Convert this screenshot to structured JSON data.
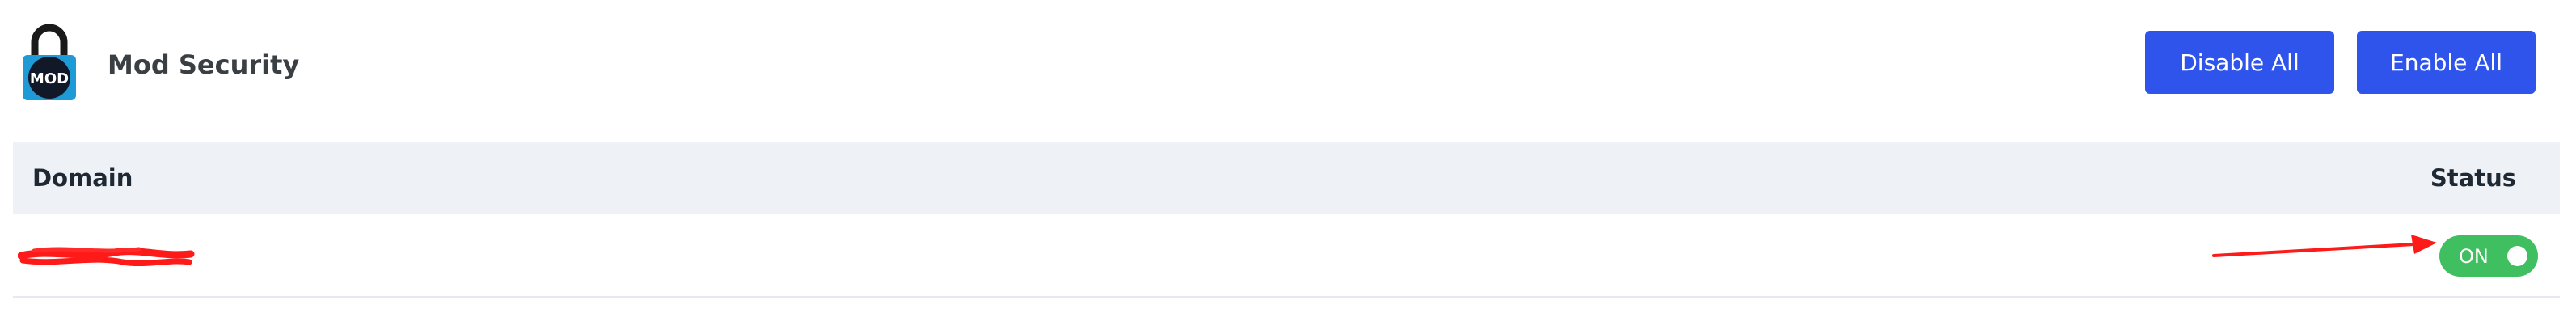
{
  "header": {
    "title": "Mod Security",
    "logo_icon": "mod-lock-icon",
    "logo_text": "MOD",
    "buttons": {
      "disable_all": "Disable All",
      "enable_all": "Enable All"
    }
  },
  "table": {
    "columns": [
      "Domain",
      "Status"
    ],
    "rows": [
      {
        "domain": "",
        "domain_redacted": true,
        "status": "ON",
        "enabled": true
      }
    ]
  },
  "annotation": {
    "arrow_color": "#ff1a1a",
    "points_to": "status-toggle"
  },
  "colors": {
    "primary_button": "#2f54eb",
    "toggle_on": "#3fbf5f",
    "header_bg": "#eef1f6",
    "redaction": "#ff1a1a"
  }
}
